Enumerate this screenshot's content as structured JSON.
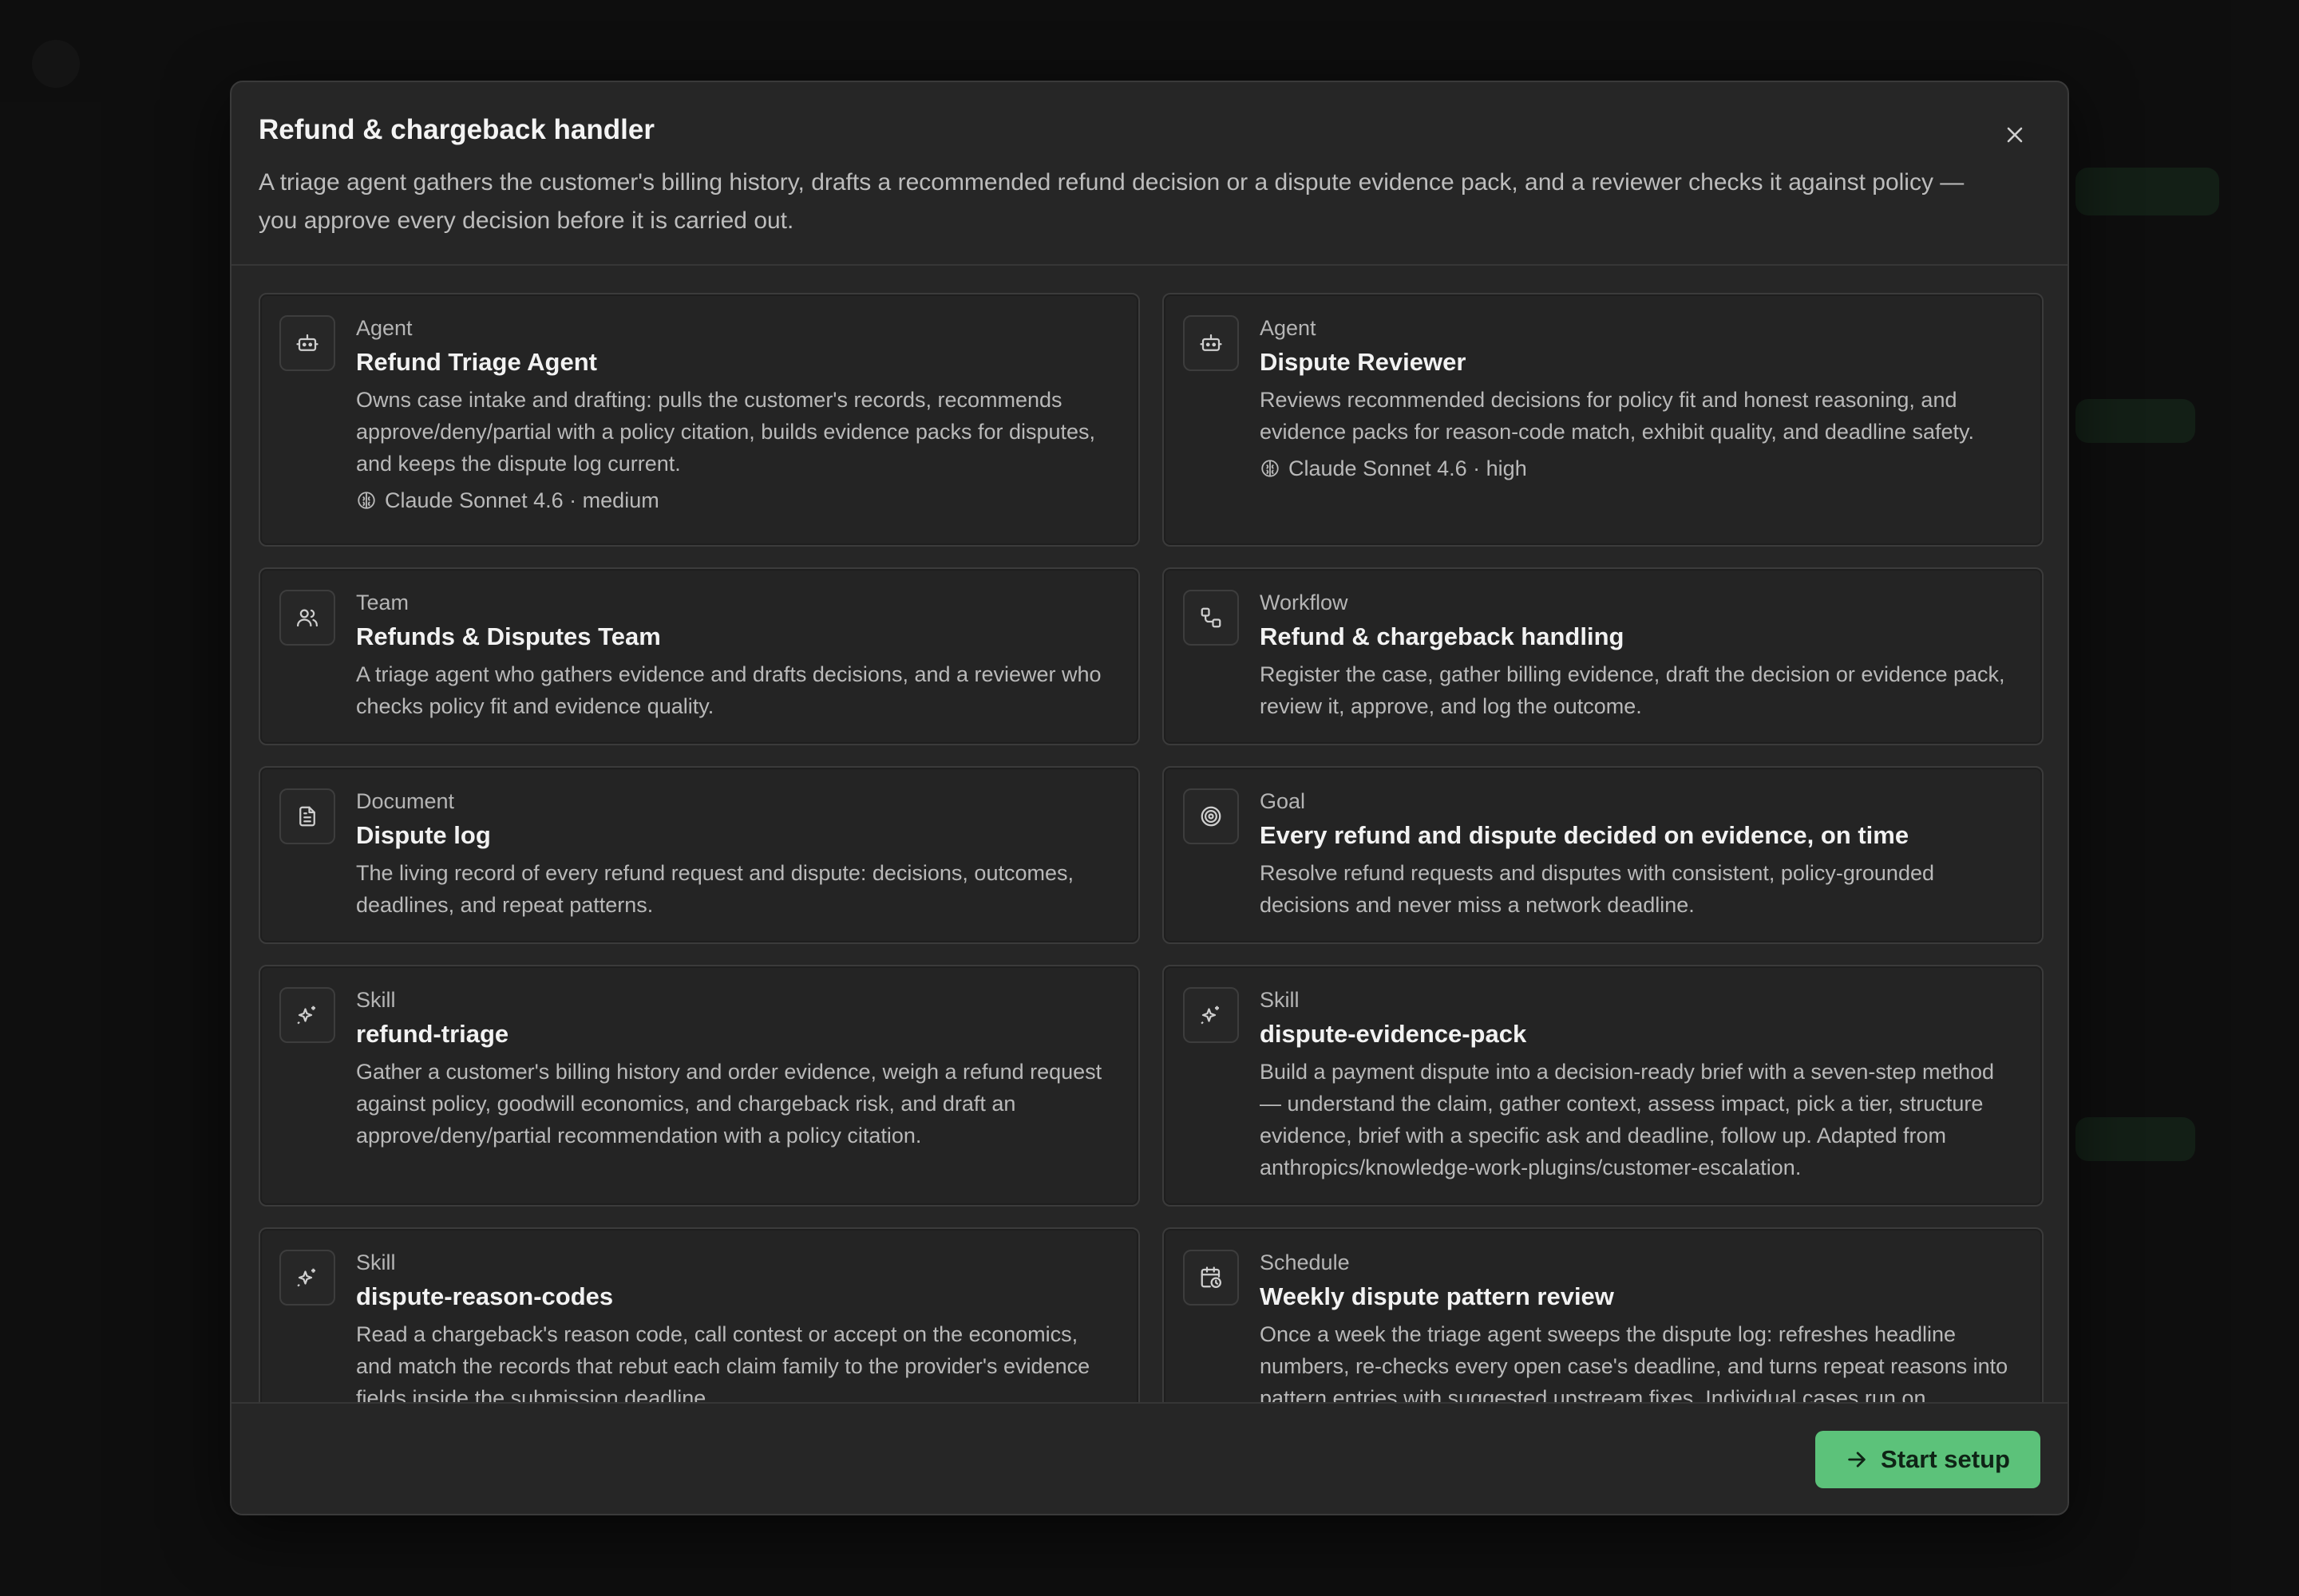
{
  "modal": {
    "title": "Refund & chargeback handler",
    "description": "A triage agent gathers the customer's billing history, drafts a recommended refund decision or a dispute evidence pack, and a reviewer checks it against policy — you approve every decision before it is carried out."
  },
  "cards": [
    {
      "kind": "Agent",
      "name": "Refund Triage Agent",
      "text": "Owns case intake and drafting: pulls the customer's records, recommends approve/deny/partial with a policy citation, builds evidence packs for disputes, and keeps the dispute log current.",
      "model": "Claude Sonnet 4.6 · medium",
      "icon": "robot-icon"
    },
    {
      "kind": "Agent",
      "name": "Dispute Reviewer",
      "text": "Reviews recommended decisions for policy fit and honest reasoning, and evidence packs for reason-code match, exhibit quality, and deadline safety.",
      "model": "Claude Sonnet 4.6 · high",
      "icon": "robot-icon"
    },
    {
      "kind": "Team",
      "name": "Refunds & Disputes Team",
      "text": "A triage agent who gathers evidence and drafts decisions, and a reviewer who checks policy fit and evidence quality.",
      "icon": "users-icon"
    },
    {
      "kind": "Workflow",
      "name": "Refund & chargeback handling",
      "text": "Register the case, gather billing evidence, draft the decision or evidence pack, review it, approve, and log the outcome.",
      "icon": "workflow-icon"
    },
    {
      "kind": "Document",
      "name": "Dispute log",
      "text": "The living record of every refund request and dispute: decisions, outcomes, deadlines, and repeat patterns.",
      "icon": "document-icon"
    },
    {
      "kind": "Goal",
      "name": "Every refund and dispute decided on evidence, on time",
      "text": "Resolve refund requests and disputes with consistent, policy-grounded decisions and never miss a network deadline.",
      "icon": "target-icon"
    },
    {
      "kind": "Skill",
      "name": "refund-triage",
      "text": "Gather a customer's billing history and order evidence, weigh a refund request against policy, goodwill economics, and chargeback risk, and draft an approve/deny/partial recommendation with a policy citation.",
      "icon": "sparkle-icon"
    },
    {
      "kind": "Skill",
      "name": "dispute-evidence-pack",
      "text": "Build a payment dispute into a decision-ready brief with a seven-step method — understand the claim, gather context, assess impact, pick a tier, structure evidence, brief with a specific ask and deadline, follow up. Adapted from anthropics/knowledge-work-plugins/customer-escalation.",
      "icon": "sparkle-icon"
    },
    {
      "kind": "Skill",
      "name": "dispute-reason-codes",
      "text": "Read a chargeback's reason code, call contest or accept on the economics, and match the records that rebut each claim family to the provider's evidence fields inside the submission deadline.",
      "icon": "sparkle-icon"
    },
    {
      "kind": "Schedule",
      "name": "Weekly dispute pattern review",
      "text": "Once a week the triage agent sweeps the dispute log: refreshes headline numbers, re-checks every open case's deadline, and turns repeat reasons into pattern entries with suggested upstream fixes. Individual cases run on",
      "icon": "calendar-clock-icon"
    }
  ],
  "footer": {
    "start_label": "Start setup"
  },
  "colors": {
    "accent": "#5cc27a",
    "modal_bg": "#262626",
    "card_border": "#3b3b3b"
  }
}
